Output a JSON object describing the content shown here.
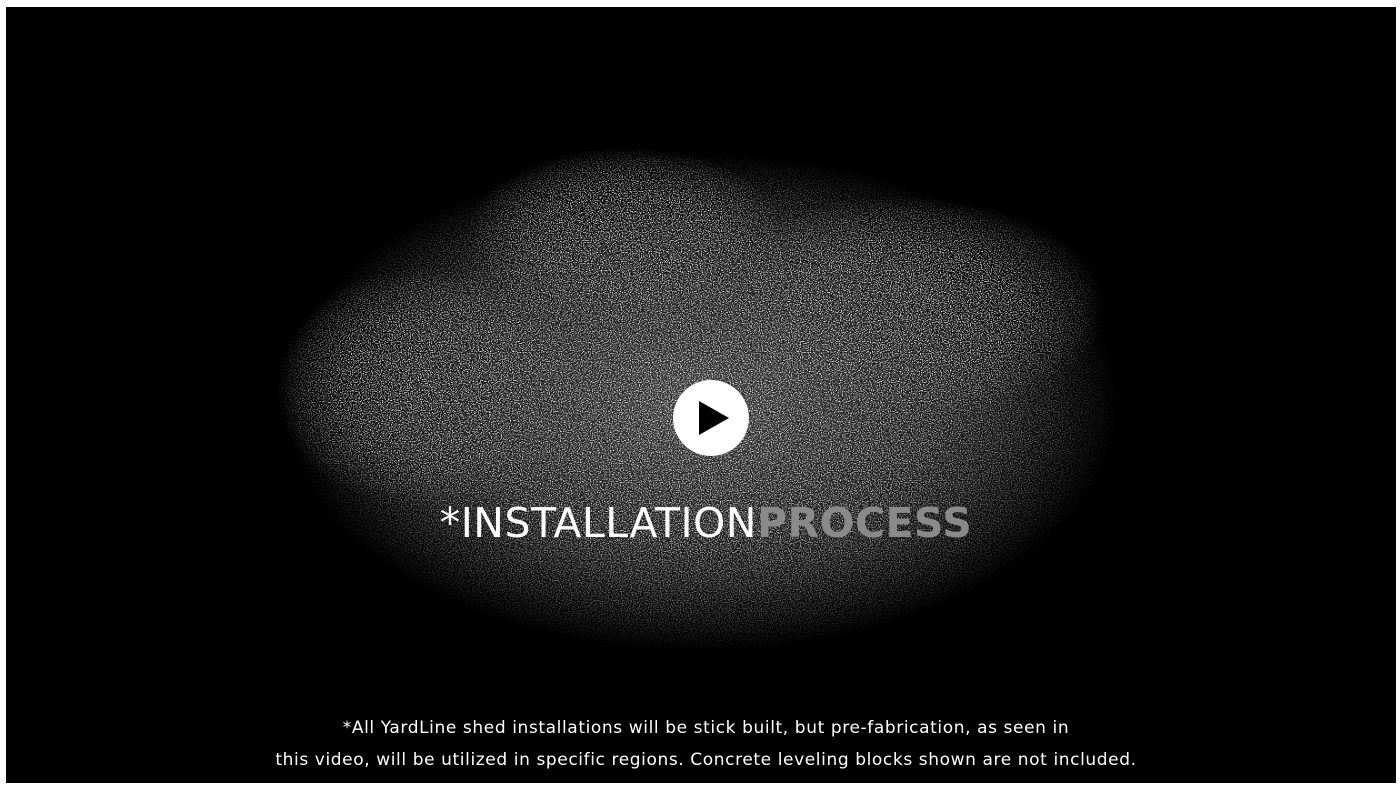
{
  "video": {
    "play_icon": "play-icon",
    "title_prefix": "*INSTALLATION",
    "title_suffix": "PROCESS",
    "disclaimer_line1": "*All YardLine shed installations will be stick built, but pre-fabrication, as seen in",
    "disclaimer_line2": "this video, will be utilized in specific regions. Concrete leveling blocks shown are not included."
  },
  "colors": {
    "background": "#000000",
    "glow": "#9a9a9a",
    "title_prefix": "#ffffff",
    "title_suffix": "#8a8a8a",
    "play_button": "#ffffff",
    "play_glyph": "#000000"
  }
}
